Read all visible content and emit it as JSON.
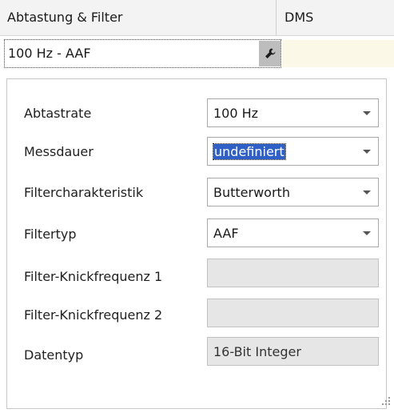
{
  "header": {
    "tab_left": "Abtastung & Filter",
    "tab_right": "DMS"
  },
  "value_row": {
    "value": "100 Hz - AAF"
  },
  "form": {
    "rows": [
      {
        "label": "Abtastrate",
        "value": "100 Hz",
        "type": "dropdown"
      },
      {
        "label": "Messdauer",
        "value": "undefiniert",
        "type": "dropdown-selected"
      },
      {
        "label": "Filtercharakteristik",
        "value": "Butterworth",
        "type": "dropdown"
      },
      {
        "label": "Filtertyp",
        "value": "AAF",
        "type": "dropdown"
      },
      {
        "label": "Filter-Knickfrequenz 1",
        "value": "",
        "type": "readonly"
      },
      {
        "label": "Filter-Knickfrequenz 2",
        "value": "",
        "type": "readonly"
      },
      {
        "label": "Datentyp",
        "value": "16-Bit Integer",
        "type": "readonly"
      }
    ]
  },
  "icons": {
    "settings": "wrench-icon",
    "dropdown": "chevron-down-icon",
    "resize": "resize-grip-icon"
  },
  "colors": {
    "selection": "#2f60c8",
    "readonly_bg": "#e6e6e6",
    "beige_cell": "#fbf8e8"
  }
}
